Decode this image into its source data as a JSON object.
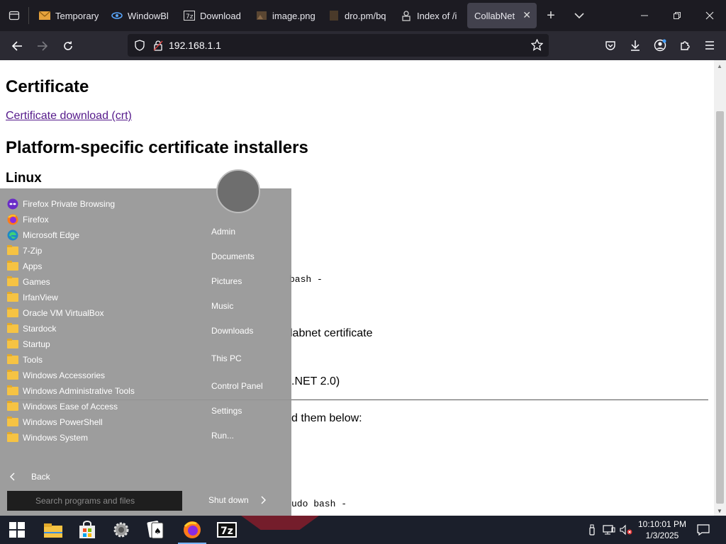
{
  "browser": {
    "tabs": [
      {
        "title": "Temporary",
        "icon": "mail-icon"
      },
      {
        "title": "WindowBl",
        "icon": "eye-icon"
      },
      {
        "title": "Download",
        "icon": "download-page-icon"
      },
      {
        "title": "image.png",
        "icon": "image-icon"
      },
      {
        "title": "dro.pm/bq",
        "icon": "page-icon"
      },
      {
        "title": "Index of /i",
        "icon": "server-icon"
      },
      {
        "title": "CollabNet",
        "icon": "none",
        "active": true
      }
    ],
    "url": "192.168.1.1"
  },
  "page": {
    "heading1": "Certificate",
    "download_link": "Certificate download (crt)",
    "heading2": "Platform-specific certificate installers",
    "heading3": "Linux",
    "fragments": {
      "bash1": "bash -",
      "collabnet_cert": "labnet certificate",
      "net": ".NET 2.0)",
      "them_below": "d them below:",
      "sudo_bash": "udo bash -"
    }
  },
  "start_menu": {
    "programs": [
      {
        "label": "Firefox Private Browsing",
        "icon": "firefox-private-icon"
      },
      {
        "label": "Firefox",
        "icon": "firefox-icon"
      },
      {
        "label": "Microsoft Edge",
        "icon": "edge-icon"
      },
      {
        "label": "7-Zip",
        "icon": "folder-icon"
      },
      {
        "label": "Apps",
        "icon": "folder-icon"
      },
      {
        "label": "Games",
        "icon": "folder-icon"
      },
      {
        "label": "IrfanView",
        "icon": "folder-icon"
      },
      {
        "label": "Oracle VM VirtualBox",
        "icon": "folder-icon"
      },
      {
        "label": "Stardock",
        "icon": "folder-icon"
      },
      {
        "label": "Startup",
        "icon": "folder-icon"
      },
      {
        "label": "Tools",
        "icon": "folder-icon"
      },
      {
        "label": "Windows Accessories",
        "icon": "folder-icon"
      },
      {
        "label": "Windows Administrative Tools",
        "icon": "folder-icon"
      },
      {
        "label": "Windows Ease of Access",
        "icon": "folder-icon"
      },
      {
        "label": "Windows PowerShell",
        "icon": "folder-icon"
      },
      {
        "label": "Windows System",
        "icon": "folder-icon"
      }
    ],
    "right_items": [
      "Admin",
      "Documents",
      "Pictures",
      "Music",
      "Downloads",
      "This PC",
      "Control Panel",
      "Settings",
      "Run..."
    ],
    "back_label": "Back",
    "search_placeholder": "Search programs and files",
    "shutdown_label": "Shut down"
  },
  "taskbar": {
    "items": [
      "start-icon",
      "file-explorer-icon",
      "store-icon",
      "settings-gear-icon",
      "solitaire-icon",
      "firefox-icon",
      "7zip-icon"
    ],
    "time": "10:10:01 PM",
    "date": "1/3/2025"
  }
}
